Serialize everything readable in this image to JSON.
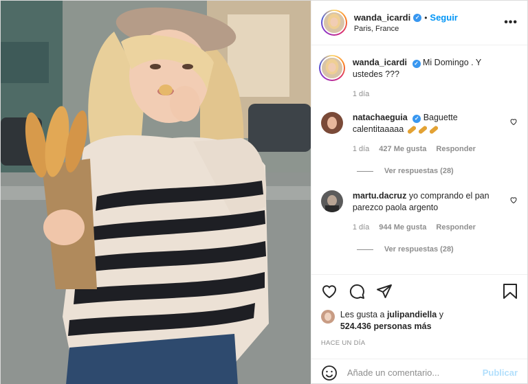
{
  "header": {
    "username": "wanda_icardi",
    "verified_icon": "verified-badge-icon",
    "separator": "•",
    "follow_label": "Seguir",
    "location": "Paris, France",
    "more_label": "•••"
  },
  "caption": {
    "username": "wanda_icardi",
    "text": "Mi Domingo . Y ustedes ???",
    "time": "1 día"
  },
  "comments": [
    {
      "username": "natachaeguia",
      "verified": true,
      "text": "Baguette calentitaaaaa",
      "time": "1 día",
      "likes": "427 Me gusta",
      "reply_label": "Responder",
      "view_replies": "Ver respuestas (28)"
    },
    {
      "username": "martu.dacruz",
      "verified": false,
      "text": "yo comprando el pan parezco paola argento",
      "time": "1 día",
      "likes": "944 Me gusta",
      "reply_label": "Responder",
      "view_replies": "Ver respuestas (28)"
    }
  ],
  "likes": {
    "prefix": "Les gusta a",
    "user": "julipandiella",
    "joiner": "y",
    "count": "524.436 personas más"
  },
  "timestamp": "HACE UN DÍA",
  "add_comment": {
    "placeholder": "Añade un comentario...",
    "publish_label": "Publicar"
  },
  "colors": {
    "accent": "#0095f6",
    "verified": "#3897f0",
    "muted": "#8e8e8e",
    "publish_disabled": "#b2dffc"
  },
  "icons": [
    "heart-icon",
    "comment-icon",
    "share-icon",
    "bookmark-icon",
    "emoji-icon",
    "more-options-icon"
  ]
}
